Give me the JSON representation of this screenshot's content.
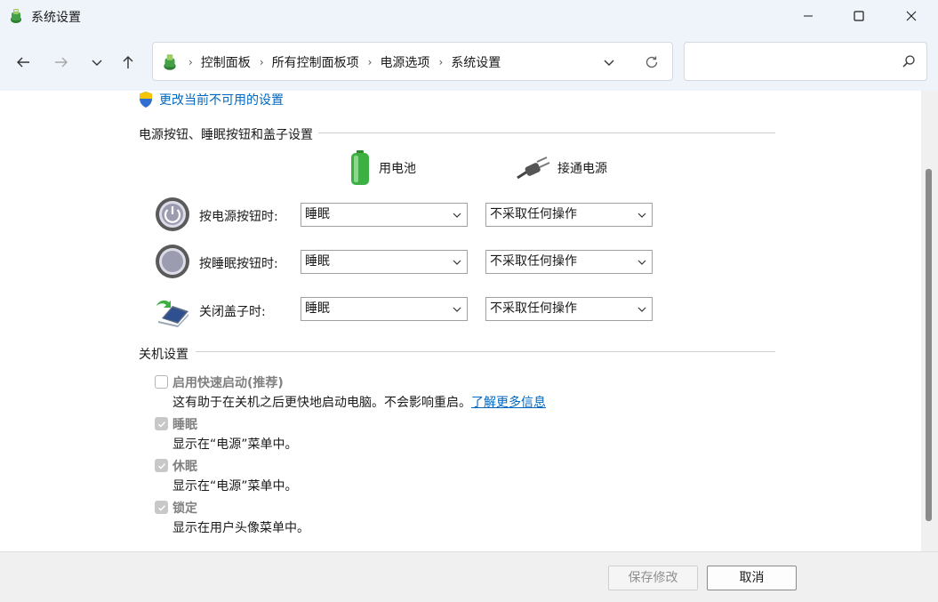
{
  "window": {
    "title": "系统设置"
  },
  "breadcrumb": [
    "控制面板",
    "所有控制面板项",
    "电源选项",
    "系统设置"
  ],
  "search": {
    "placeholder": ""
  },
  "admin_link": "更改当前不可用的设置",
  "power_section": {
    "title": "电源按钮、睡眠按钮和盖子设置",
    "col_battery": "用电池",
    "col_plugged": "接通电源",
    "rows": [
      {
        "label": "按电源按钮时:",
        "battery": "睡眠",
        "plugged": "不采取任何操作",
        "icon": "power-button-icon"
      },
      {
        "label": "按睡眠按钮时:",
        "battery": "睡眠",
        "plugged": "不采取任何操作",
        "icon": "sleep-button-icon"
      },
      {
        "label": "关闭盖子时:",
        "battery": "睡眠",
        "plugged": "不采取任何操作",
        "icon": "laptop-lid-icon"
      }
    ]
  },
  "shutdown_section": {
    "title": "关机设置",
    "options": [
      {
        "label": "启用快速启动(推荐)",
        "checked": false,
        "desc": "这有助于在关机之后更快地启动电脑。不会影响重启。",
        "link": "了解更多信息"
      },
      {
        "label": "睡眠",
        "checked": true,
        "desc": "显示在“电源”菜单中。"
      },
      {
        "label": "休眠",
        "checked": true,
        "desc": "显示在“电源”菜单中。"
      },
      {
        "label": "锁定",
        "checked": true,
        "desc": "显示在用户头像菜单中。"
      }
    ]
  },
  "footer": {
    "save_label": "保存修改",
    "cancel_label": "取消"
  },
  "colors": {
    "accent": "#0067c0",
    "titlebar_bg": "#eef4f9",
    "battery_green": "#3cb043"
  }
}
